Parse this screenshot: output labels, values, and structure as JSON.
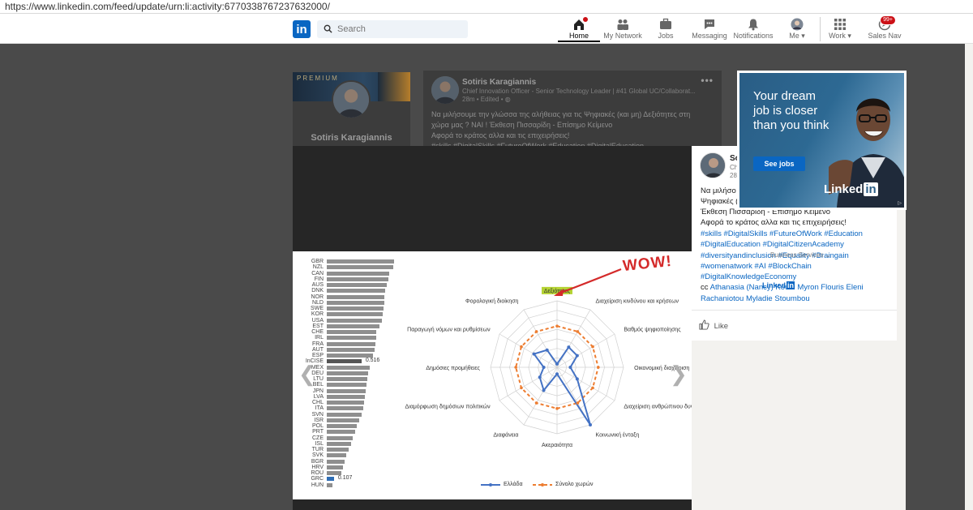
{
  "browser": {
    "url": "https://www.linkedin.com/feed/update/urn:li:activity:6770338767237632000/"
  },
  "nav": {
    "logo": "in",
    "search_placeholder": "Search",
    "items": [
      {
        "label": "Home",
        "icon": "home-icon"
      },
      {
        "label": "My Network",
        "icon": "people-icon"
      },
      {
        "label": "Jobs",
        "icon": "briefcase-icon"
      },
      {
        "label": "Messaging",
        "icon": "message-icon"
      },
      {
        "label": "Notifications",
        "icon": "bell-icon"
      },
      {
        "label": "Me",
        "icon": "avatar-icon"
      },
      {
        "label": "Work",
        "icon": "grid-icon"
      },
      {
        "label": "Sales Nav",
        "icon": "compass-icon"
      }
    ],
    "sales_badge": "99+"
  },
  "profile_card": {
    "banner_label": "PREMIUM",
    "name": "Sotiris Karagiannis"
  },
  "background_post": {
    "author": "Sotiris Karagiannis",
    "headline": "Chief Innovation Officer - Senior Technology Leader | #41 Global UC/Collaborat...",
    "meta": "28m • Edited •",
    "text_lines": [
      "Να μιλήσουμε την γλώσσα της αλήθειας για τις Ψηφιακές (και μη) Δεξιότητες στη",
      "χώρα μας ? ΝΑΙ ! Έκθεση Πισσαρίδη - Επίσημο Κείμενο",
      "Αφορά το κράτος αλλα και τις επιχειρήσεις!",
      "#skills #DigitalSkills #FutureOfWork #Education #DigitalEducation"
    ]
  },
  "side_panel": {
    "author_short": "So",
    "sub1": "Ch",
    "sub2": "28",
    "text_lines": [
      "Να μιλήσο",
      "Ψηφιακές (",
      "Έκθεση Πισσαρίδη - Επίσημο Κείμενο",
      "Αφορά το κράτος αλλα και τις επιχειρήσεις!"
    ],
    "tag_lines": [
      "#skills #DigitalSkills #FutureOfWork #Education",
      "#DigitalEducation #DigitalCitizenAcademy",
      "#diversityandinclusion #Equality #Braingain",
      "#womenatwork #AI #BlockChain",
      "#DigitalKnowledgeEconomy"
    ],
    "cc_prefix": "cc ",
    "cc_names_line1": "Athanasia (Nancy) Kouni Myron Flouris Eleni",
    "cc_names_line2": "Rachaniotou Myladie Stoumbou",
    "overlay_services": "Business Services",
    "overlay_logo": "Linked",
    "like_label": "Like"
  },
  "ad": {
    "headline": "Your dream job is closer than you think",
    "button": "See jobs",
    "logo_text": "Linked",
    "logo_in": "in",
    "adchoice": "▷"
  },
  "slide": {
    "annotation": "WOW!",
    "bar_chart": {
      "countries": [
        "GBR",
        "NZL",
        "CAN",
        "FIN",
        "AUS",
        "DNK",
        "NOR",
        "NLD",
        "SWE",
        "KOR",
        "USA",
        "EST",
        "CHE",
        "IRL",
        "FRA",
        "AUT",
        "ESP",
        "InCISE",
        "MEX",
        "DEU",
        "LTU",
        "BEL",
        "JPN",
        "LVA",
        "CHL",
        "ITA",
        "SVN",
        "ISR",
        "POL",
        "PRT",
        "CZE",
        "ISL",
        "TUR",
        "SVK",
        "BGR",
        "HRV",
        "ROU",
        "GRC",
        "HUN"
      ],
      "values": [
        1.0,
        0.99,
        0.93,
        0.91,
        0.89,
        0.87,
        0.86,
        0.85,
        0.84,
        0.83,
        0.82,
        0.78,
        0.74,
        0.73,
        0.72,
        0.71,
        0.69,
        0.516,
        0.64,
        0.62,
        0.6,
        0.59,
        0.58,
        0.57,
        0.56,
        0.54,
        0.52,
        0.48,
        0.44,
        0.42,
        0.39,
        0.36,
        0.32,
        0.29,
        0.26,
        0.24,
        0.22,
        0.107,
        0.09
      ],
      "highlight_label": "0.516",
      "greece_label": "0.107"
    },
    "radar": {
      "axes": [
        "Δεξιότητες",
        "Διαχείριση κινδύνου και κρήσεων",
        "Βαθμός ψηφιοποίησης",
        "Οικονομική διαχείριση",
        "Διαχείριση ανθρώπινου δυναμικού",
        "Κοινωνική ένταξη",
        "Ακεραιότητα",
        "Διαφάνεια",
        "Διαμόρφωση δημόσιων πολιτικών",
        "Δημόσιες προμήθειες",
        "Παραγωγή νόμων και ρυθμίσεων",
        "Φορολογική διοίκηση"
      ],
      "greece": [
        0.05,
        0.35,
        0.35,
        0.2,
        0.35,
        1.0,
        0.1,
        0.4,
        0.3,
        0.2,
        0.4,
        0.3
      ],
      "total": [
        0.62,
        0.62,
        0.62,
        0.62,
        0.62,
        0.62,
        0.62,
        0.62,
        0.62,
        0.62,
        0.62,
        0.62
      ],
      "legend_greece": "Ελλάδα",
      "legend_total": "Σύνολο χωρών",
      "greece_color": "#4472c4",
      "total_color": "#ed7d31"
    }
  }
}
